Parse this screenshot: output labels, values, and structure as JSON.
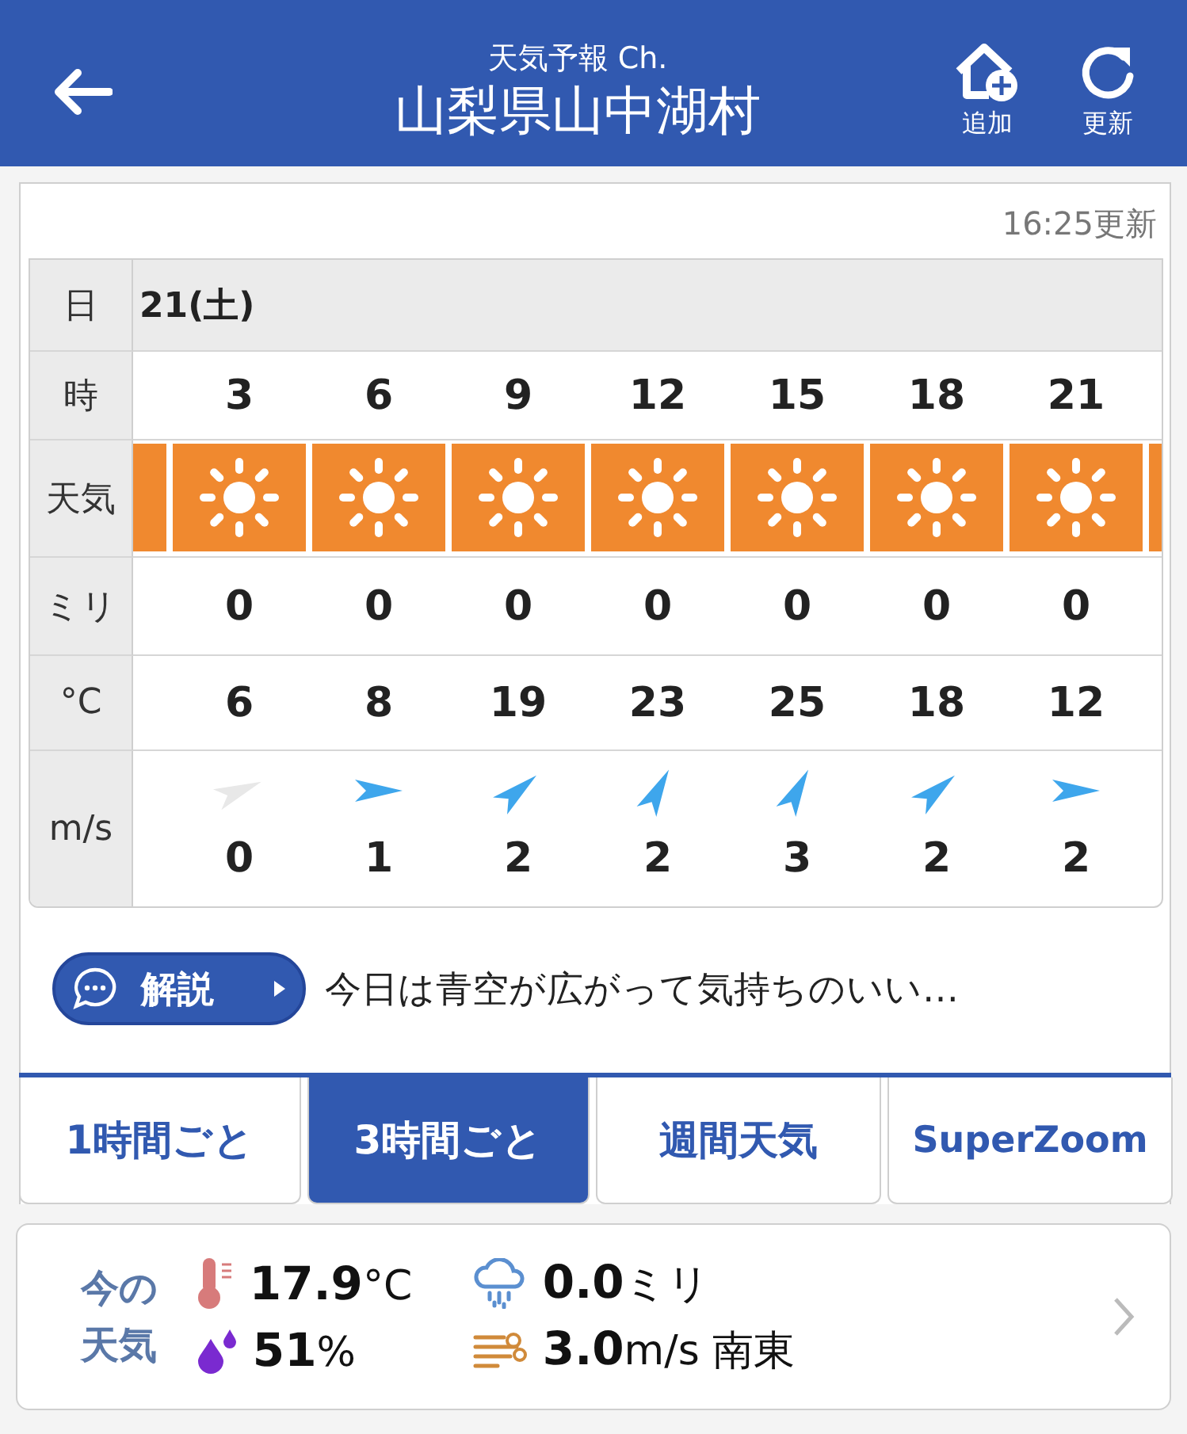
{
  "header": {
    "subtitle": "天気予報 Ch.",
    "title": "山梨県山中湖村",
    "actions": [
      {
        "kind": "add",
        "label": "追加"
      },
      {
        "kind": "refresh",
        "label": "更新"
      }
    ]
  },
  "updated": "16:25更新",
  "forecast": {
    "row_labels": {
      "date": "日",
      "hour": "時",
      "weather": "天気",
      "rain": "ミリ",
      "temp": "°C",
      "wind": "m/s"
    },
    "date": "21(土)",
    "columns": [
      {
        "kind": "sunny",
        "hour": "3",
        "rain": "0",
        "temp": "6",
        "wind": {
          "kind": "east-northeast",
          "speed": "0",
          "calm": true
        }
      },
      {
        "kind": "sunny",
        "hour": "6",
        "rain": "0",
        "temp": "8",
        "wind": {
          "kind": "east",
          "speed": "1",
          "calm": false
        }
      },
      {
        "kind": "sunny",
        "hour": "9",
        "rain": "0",
        "temp": "19",
        "wind": {
          "kind": "northeast",
          "speed": "2",
          "calm": false
        }
      },
      {
        "kind": "sunny",
        "hour": "12",
        "rain": "0",
        "temp": "23",
        "wind": {
          "kind": "north-northeast",
          "speed": "2",
          "calm": false
        }
      },
      {
        "kind": "sunny",
        "hour": "15",
        "rain": "0",
        "temp": "25",
        "wind": {
          "kind": "north-northeast",
          "speed": "3",
          "calm": false
        }
      },
      {
        "kind": "sunny",
        "hour": "18",
        "rain": "0",
        "temp": "18",
        "wind": {
          "kind": "northeast",
          "speed": "2",
          "calm": false
        }
      },
      {
        "kind": "sunny",
        "hour": "21",
        "rain": "0",
        "temp": "12",
        "wind": {
          "kind": "east",
          "speed": "2",
          "calm": false
        }
      }
    ]
  },
  "commentary": {
    "button": "解説",
    "text": "今日は青空が広がって気持ちのいい…"
  },
  "tabs": [
    {
      "label": "1時間ごと",
      "selected": false
    },
    {
      "label": "3時間ごと",
      "selected": true
    },
    {
      "label": "週間天気",
      "selected": false
    },
    {
      "label": "SuperZoom",
      "selected": false
    }
  ],
  "current": {
    "label": "今の天気",
    "items": [
      {
        "kind": "temperature",
        "text": "**17.9**°C"
      },
      {
        "kind": "rain",
        "text": "**0.0**ミリ"
      },
      {
        "kind": "humidity",
        "text": "**51**%"
      },
      {
        "kind": "wind",
        "text": "**3.0**m/s 南東"
      }
    ]
  }
}
